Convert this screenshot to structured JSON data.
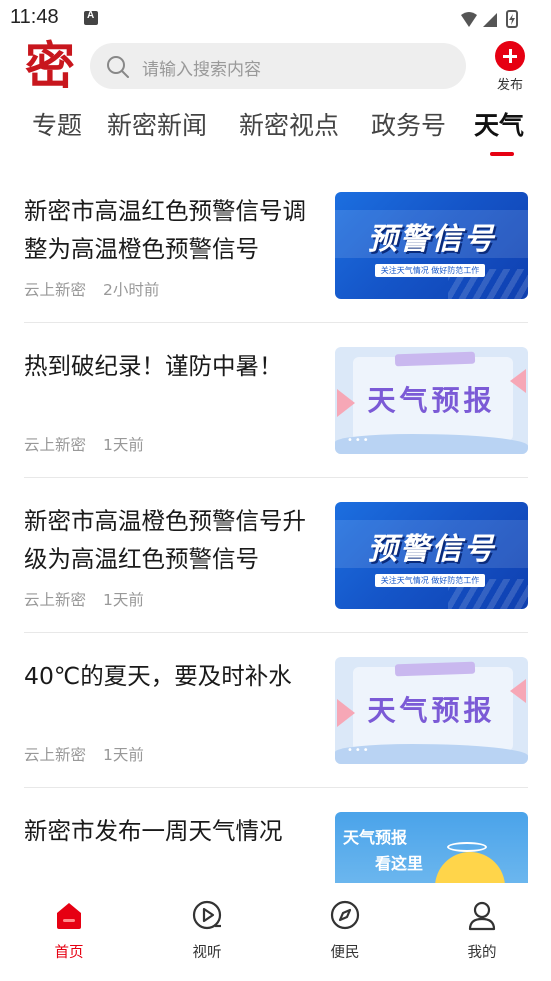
{
  "status": {
    "time": "11:48"
  },
  "header": {
    "logo_text": "密",
    "search_placeholder": "请输入搜索内容",
    "publish_label": "发布"
  },
  "tabs": [
    {
      "label": "专题"
    },
    {
      "label": "新密新闻"
    },
    {
      "label": "新密视点"
    },
    {
      "label": "政务号"
    },
    {
      "label": "天气"
    }
  ],
  "active_tab": "天气",
  "thumb_text": {
    "warning_title": "预警信号",
    "warning_sub": "关注天气情况 做好防范工作",
    "forecast_title": "天气预报",
    "forecast_dots": "•••",
    "weekly_line1": "天气预报",
    "weekly_line2": "看这里"
  },
  "articles": [
    {
      "title": "新密市高温红色预警信号调整为高温橙色预警信号",
      "source": "云上新密",
      "time": "2小时前",
      "thumb": "warning"
    },
    {
      "title": "热到破纪录！谨防中暑！",
      "source": "云上新密",
      "time": "1天前",
      "thumb": "forecast"
    },
    {
      "title": "新密市高温橙色预警信号升级为高温红色预警信号",
      "source": "云上新密",
      "time": "1天前",
      "thumb": "warning"
    },
    {
      "title": "40℃的夏天，要及时补水",
      "source": "云上新密",
      "time": "1天前",
      "thumb": "forecast"
    },
    {
      "title": "新密市发布一周天气情况",
      "source": "",
      "time": "",
      "thumb": "weekly"
    }
  ],
  "nav": [
    {
      "label": "首页",
      "icon": "home-icon",
      "active": true
    },
    {
      "label": "视听",
      "icon": "play-icon",
      "active": false
    },
    {
      "label": "便民",
      "icon": "compass-icon",
      "active": false
    },
    {
      "label": "我的",
      "icon": "user-icon",
      "active": false
    }
  ],
  "colors": {
    "accent": "#e60012",
    "logo": "#c8161d"
  }
}
